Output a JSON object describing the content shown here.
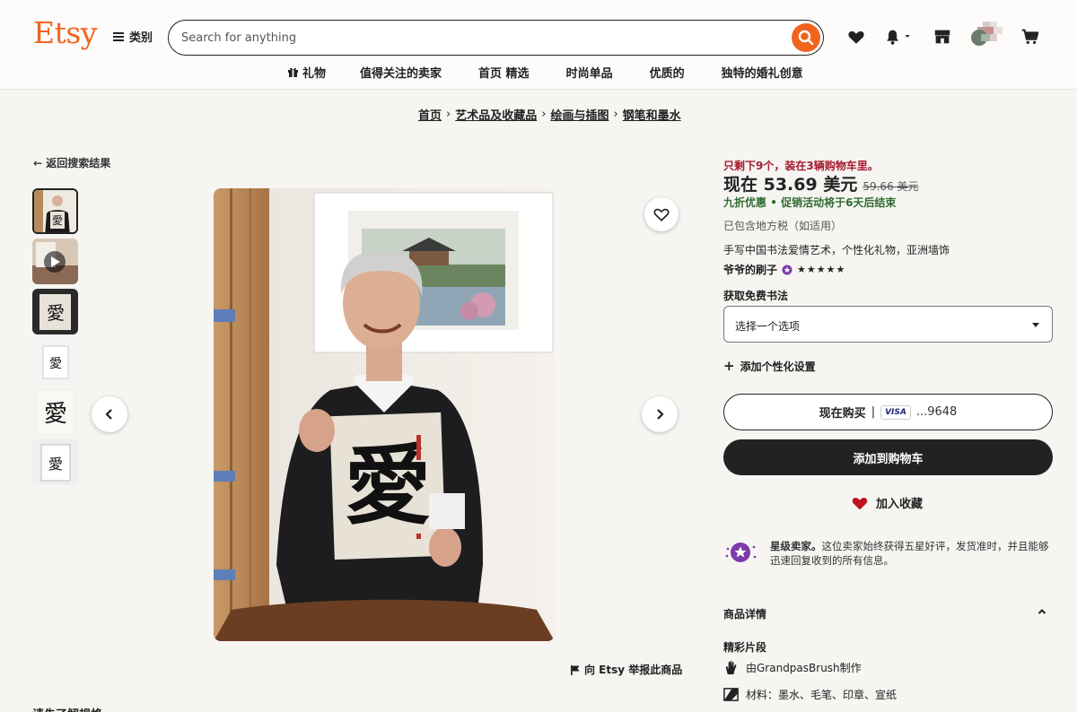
{
  "header": {
    "logo": "Etsy",
    "categories_label": "类别",
    "search_placeholder": "Search for anything",
    "nav": [
      "礼物",
      "值得关注的卖家",
      "首页 精选",
      "时尚单品",
      "优质的",
      "独特的婚礼创意"
    ]
  },
  "breadcrumb": [
    "首页",
    "艺术品及收藏品",
    "绘画与插图",
    "钢笔和墨水"
  ],
  "back_label": "返回搜索结果",
  "gallery": {
    "thumbnail_count": 6,
    "active_index": 0
  },
  "report_label": "向 Etsy 举报此商品",
  "bottom_text": "请先了解规格",
  "product": {
    "stock_text": "只剩下9个，装在3辆购物车里。",
    "price_now": "现在 53.69 美元",
    "price_old": "59.66 美元",
    "promo_discount": "九折优惠",
    "promo_text": "促销活动将于6天后结束",
    "tax_text": "已包含地方税（如适用）",
    "title": "手写中国书法爱情艺术，个性化礼物，亚洲墙饰",
    "shop_name": "爷爷的刷子",
    "rating_stars": "★★★★★",
    "option_label": "获取免费书法",
    "option_select": "选择一个选项",
    "personalize_label": "添加个性化设置",
    "buy_now_label": "现在购买",
    "buy_now_sep": "|",
    "visa_label": "VISA",
    "card_number": "...9648",
    "add_to_cart_label": "添加到购物车",
    "favorite_label": "加入收藏",
    "star_seller_title": "星级卖家。",
    "star_seller_text": "这位卖家始终获得五星好评，发货准时，并且能够迅速回复收到的所有信息。",
    "details_label": "商品详情",
    "highlights_label": "精彩片段",
    "highlight_made_by": "由GrandpasBrush制作",
    "highlight_materials": "材料：墨水、毛笔、印章、宣纸"
  },
  "colors": {
    "accent": "#f1641e",
    "stock_red": "#a61a2e",
    "promo_green": "#2f6b2e",
    "dark": "#222222",
    "star_purple": "#7c3aab"
  }
}
